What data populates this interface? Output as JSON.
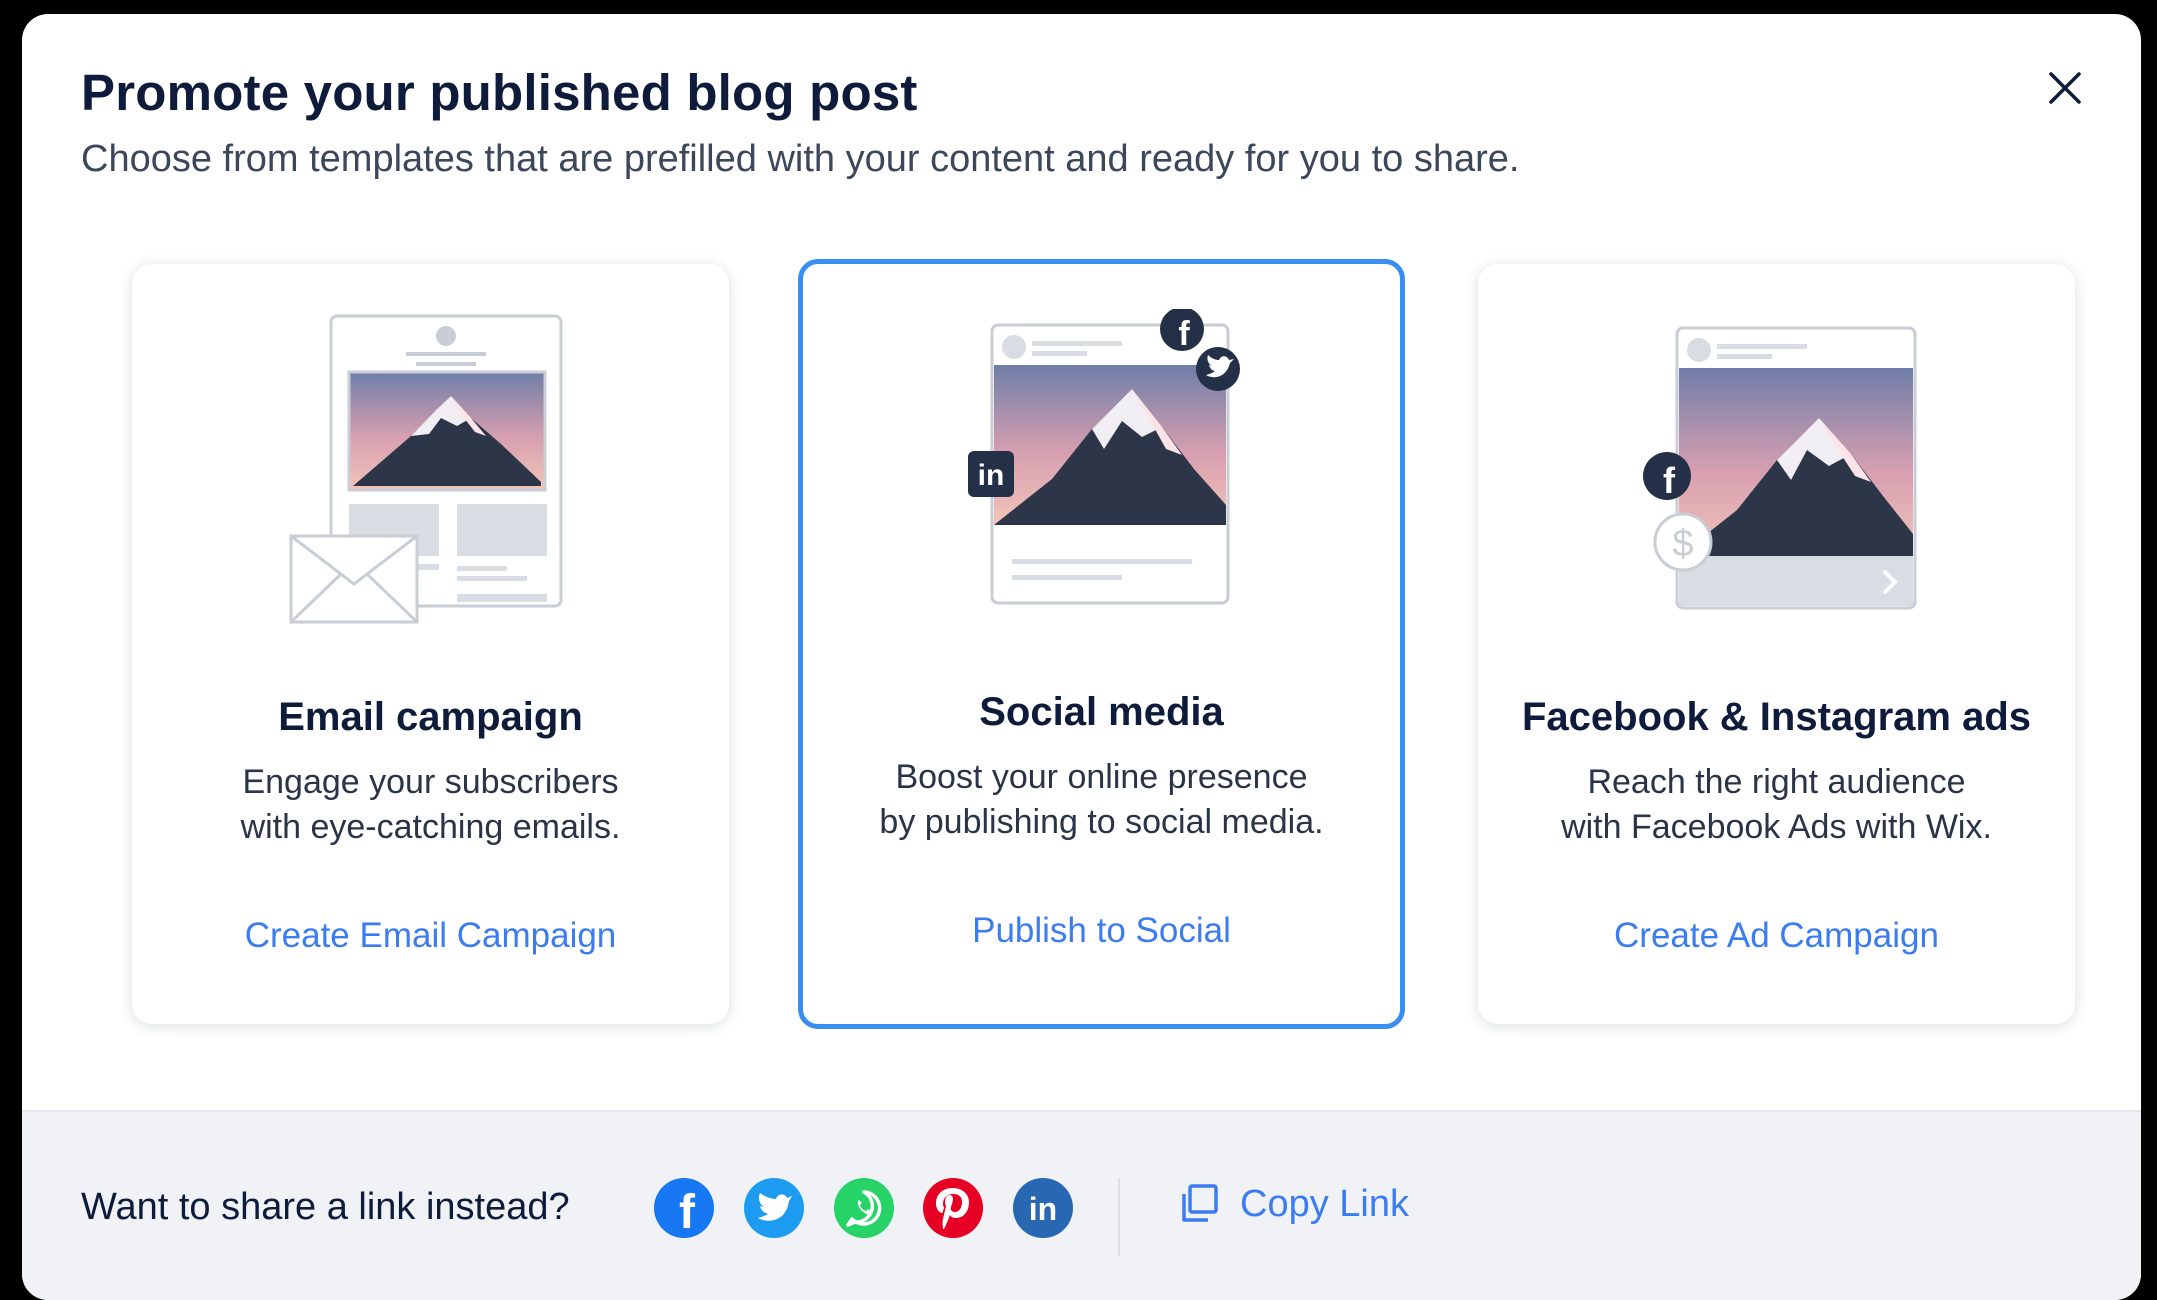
{
  "modal": {
    "title": "Promote your published blog post",
    "subtitle": "Choose from templates that are prefilled with your content and ready for you to share."
  },
  "cards": [
    {
      "title": "Email campaign",
      "desc_line1": "Engage your subscribers",
      "desc_line2": "with eye-catching emails.",
      "link": "Create Email Campaign",
      "selected": false
    },
    {
      "title": "Social media",
      "desc_line1": "Boost your online presence",
      "desc_line2": "by publishing to social media.",
      "link": "Publish to Social",
      "selected": true
    },
    {
      "title": "Facebook & Instagram ads",
      "desc_line1": "Reach the right audience",
      "desc_line2": "with Facebook Ads with Wix.",
      "link": "Create Ad Campaign",
      "selected": false
    }
  ],
  "footer": {
    "question": "Want to share a link instead?",
    "share_icons": [
      "facebook-icon",
      "twitter-icon",
      "whatsapp-icon",
      "pinterest-icon",
      "linkedin-icon"
    ],
    "copy_link": "Copy Link"
  },
  "colors": {
    "accent": "#3b7cf0",
    "selected_border": "#3b8ef1",
    "facebook": "#1877f2",
    "twitter": "#1d9bf0",
    "whatsapp": "#25d366",
    "pinterest": "#e60023",
    "linkedin": "#2867b2",
    "title": "#0e1b3a"
  }
}
